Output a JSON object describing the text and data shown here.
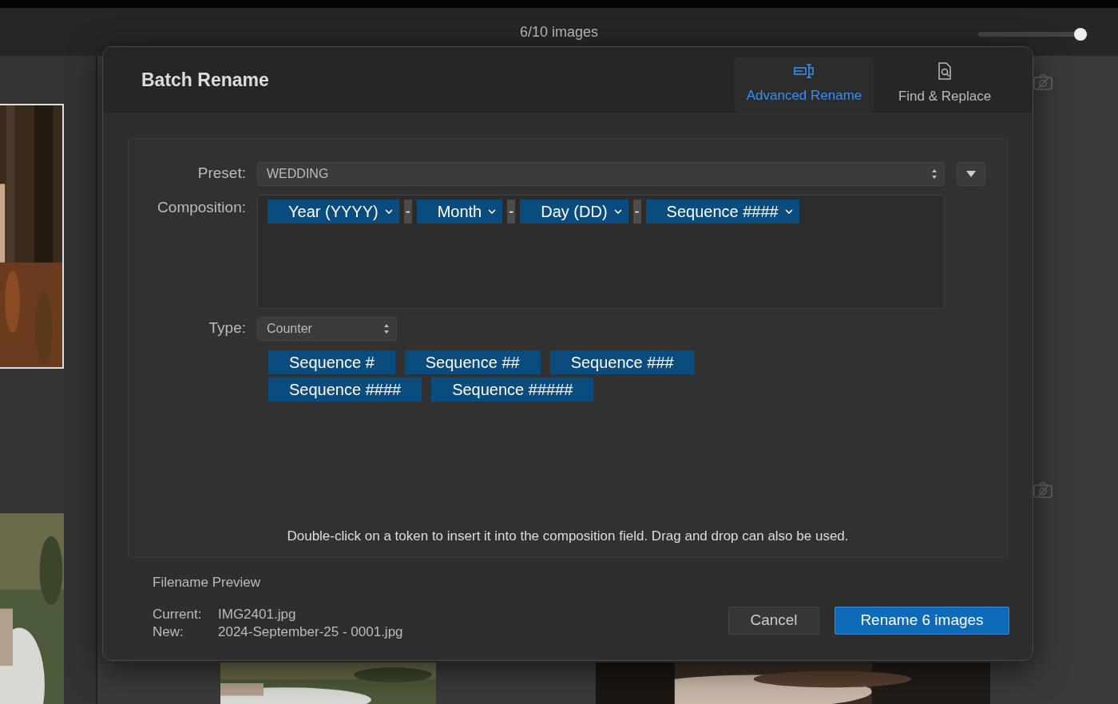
{
  "toolbar": {
    "title": "6/10 images",
    "zoom_slider": {
      "level": 0.93
    }
  },
  "dialog": {
    "title": "Batch Rename",
    "tabs": [
      {
        "label": "Advanced Rename",
        "selected": true
      },
      {
        "label": "Find & Replace",
        "selected": false
      }
    ],
    "preset": {
      "label": "Preset:",
      "value": "WEDDING"
    },
    "composition": {
      "label": "Composition:",
      "items": [
        {
          "kind": "token",
          "label": "Year (YYYY)"
        },
        {
          "kind": "separator",
          "label": "-"
        },
        {
          "kind": "token",
          "label": "Month"
        },
        {
          "kind": "separator",
          "label": "-"
        },
        {
          "kind": "token",
          "label": "Day (DD)"
        },
        {
          "kind": "separator",
          "label": "-"
        },
        {
          "kind": "token",
          "label": "Sequence ####"
        }
      ]
    },
    "type": {
      "label": "Type:",
      "value": "Counter"
    },
    "tokens": [
      [
        "Sequence #",
        "Sequence ##",
        "Sequence ###"
      ],
      [
        "Sequence ####",
        "Sequence #####"
      ]
    ],
    "hint": "Double-click on a token to insert it into the composition field. Drag and drop can also be used.",
    "preview": {
      "title": "Filename Preview",
      "rows": [
        {
          "label": "Current:",
          "value": "IMG2401.jpg"
        },
        {
          "label": "New:",
          "value": "2024-September-25 - 0001.jpg"
        }
      ]
    },
    "buttons": [
      {
        "label": "Cancel",
        "primary": false
      },
      {
        "label": "Rename 6 images",
        "primary": true
      }
    ]
  }
}
